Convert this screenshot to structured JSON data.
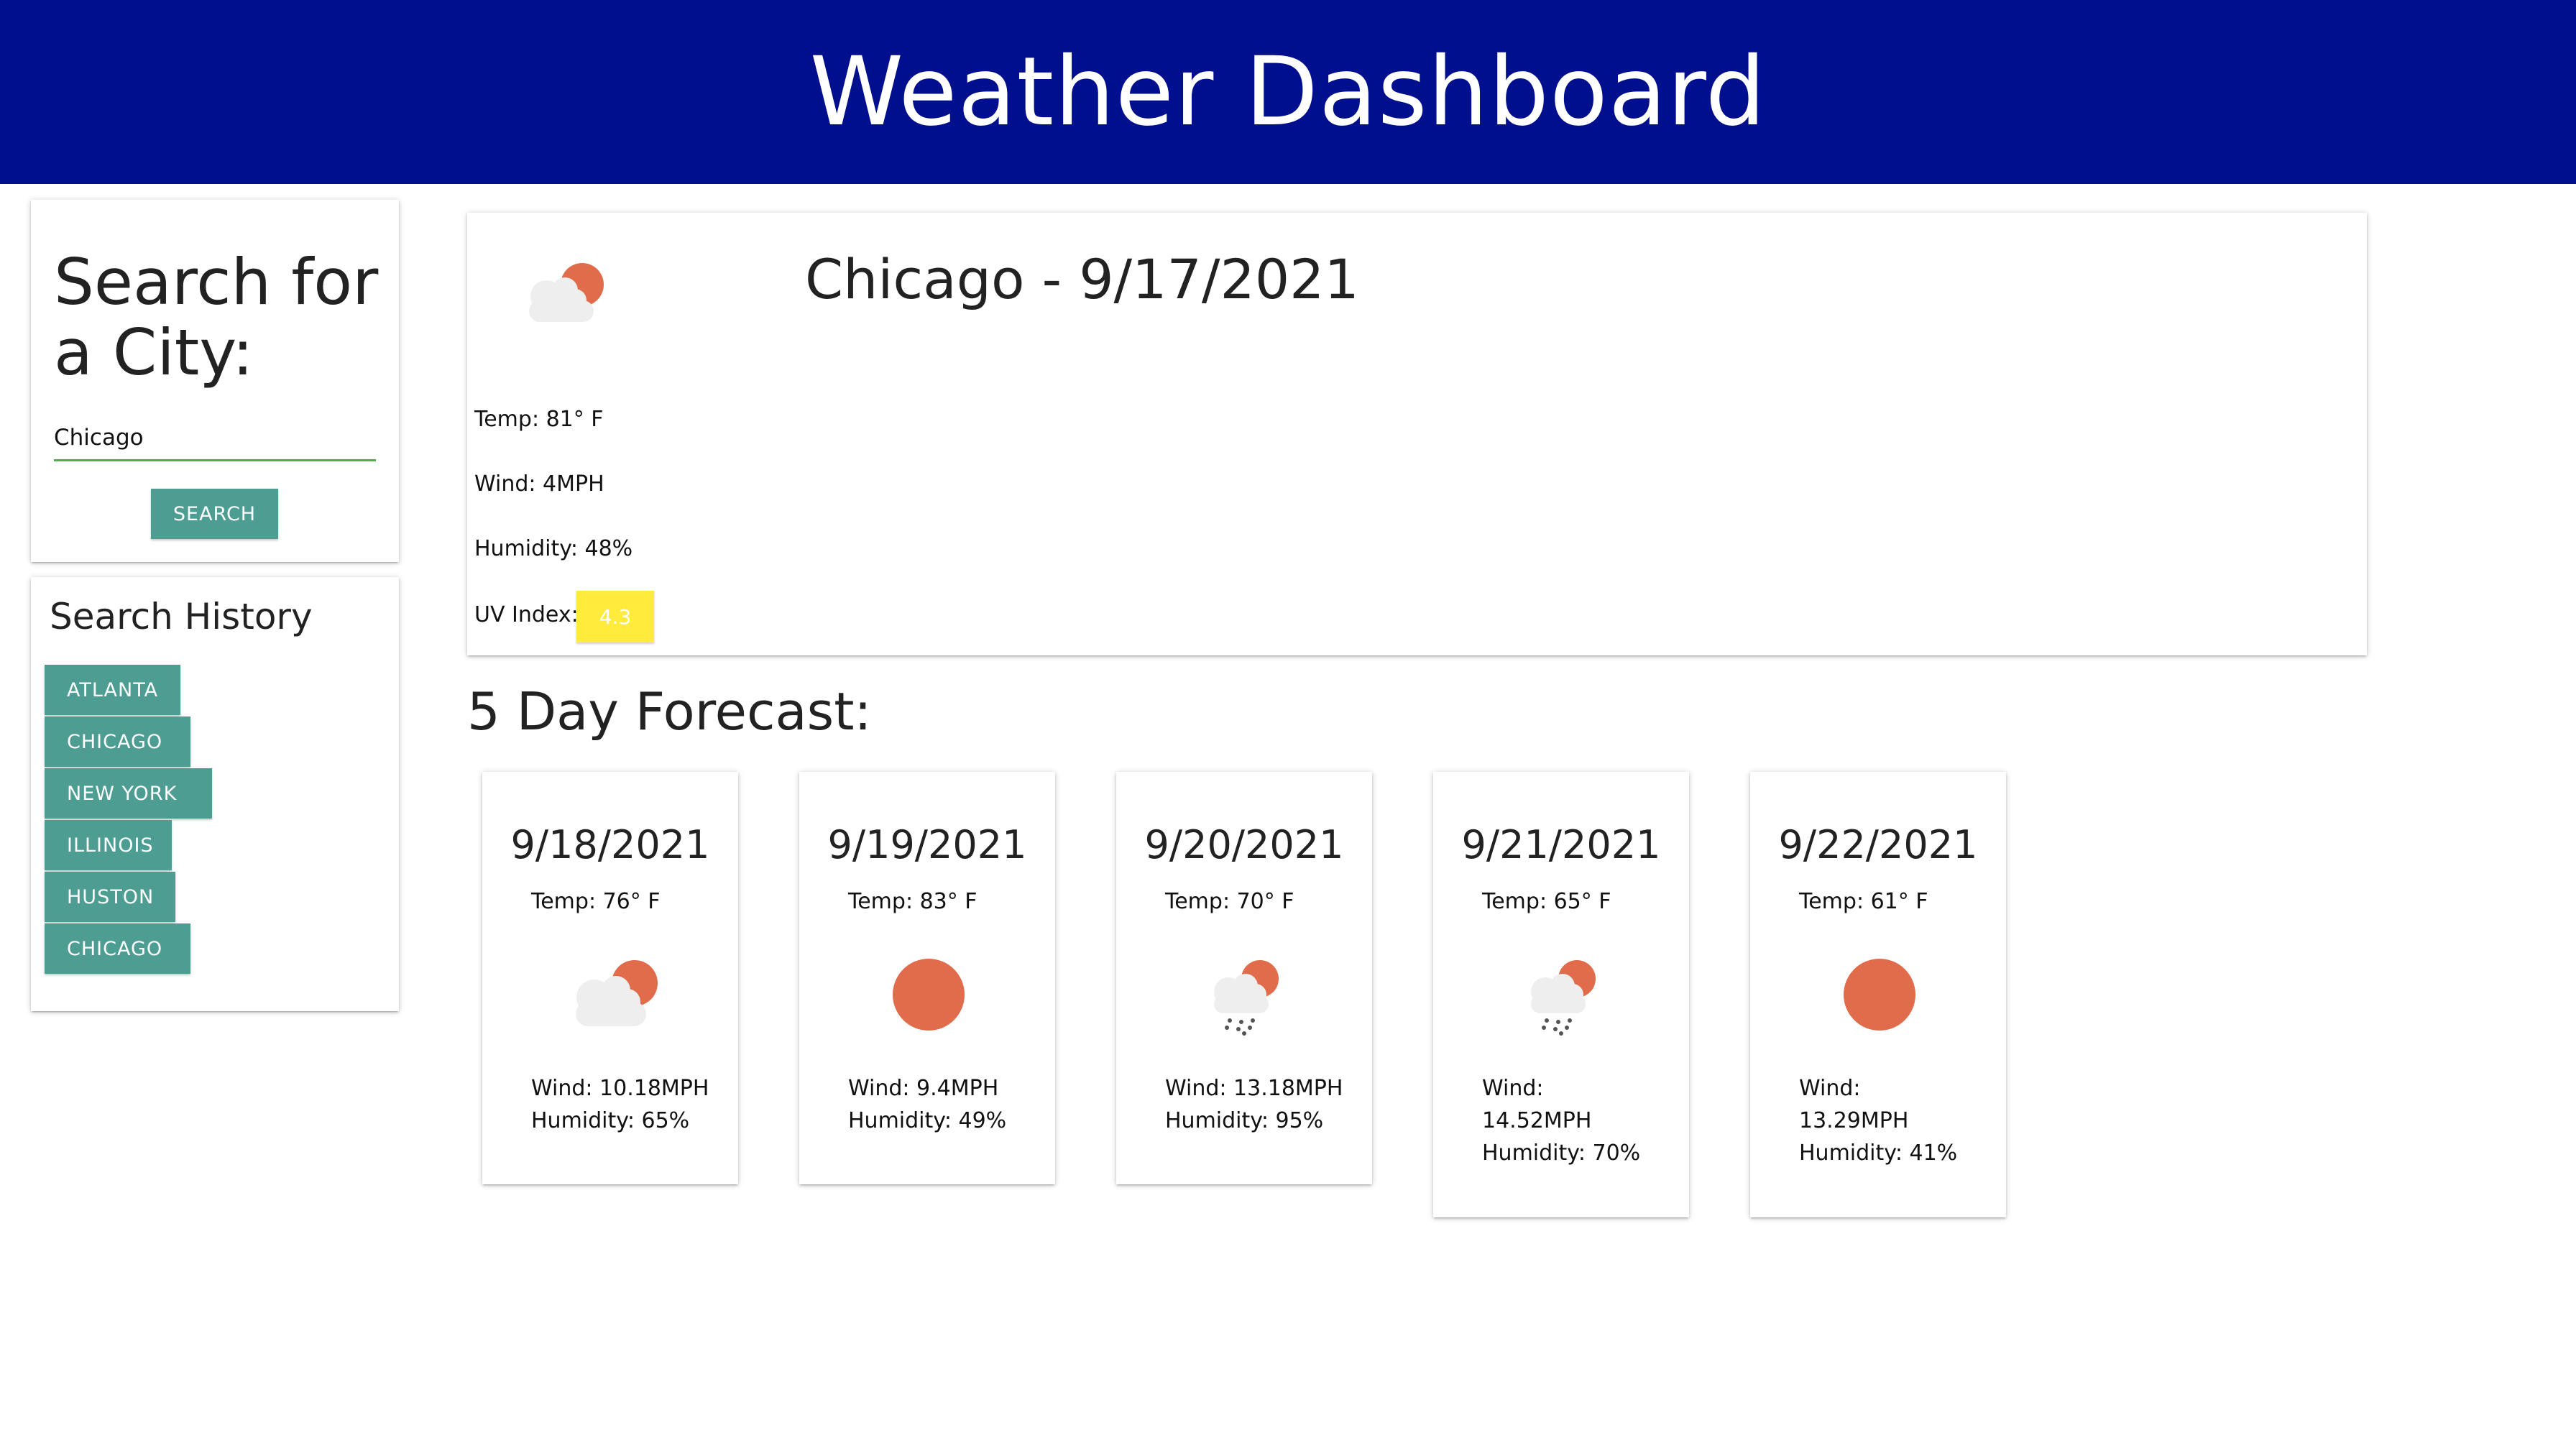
{
  "header": {
    "title": "Weather Dashboard"
  },
  "search": {
    "title": "Search for a City:",
    "input_value": "Chicago",
    "button_label": "SEARCH"
  },
  "history": {
    "title": "Search History",
    "items": [
      "ATLANTA",
      "CHICAGO",
      "NEW YORK",
      "ILLINOIS",
      "HUSTON",
      "CHICAGO"
    ]
  },
  "current": {
    "title": "Chicago - 9/17/2021",
    "icon": "sun-behind-cloud-icon",
    "temp": "Temp: 81° F",
    "wind": "Wind: 4MPH",
    "humidity": "Humidity: 48%",
    "uv_label": "UV Index:",
    "uv_value": "4.3",
    "uv_color": "#ffeb3b"
  },
  "forecast": {
    "heading": "5 Day Forecast:",
    "days": [
      {
        "date": "9/18/2021",
        "temp": "Temp: 76° F",
        "icon": "sun-behind-cloud-icon",
        "wind": "Wind: 10.18MPH",
        "humidity": "Humidity: 65%"
      },
      {
        "date": "9/19/2021",
        "temp": "Temp: 83° F",
        "icon": "sun-icon",
        "wind": "Wind: 9.4MPH",
        "humidity": "Humidity: 49%"
      },
      {
        "date": "9/20/2021",
        "temp": "Temp: 70° F",
        "icon": "rain-cloud-sun-icon",
        "wind": "Wind: 13.18MPH",
        "humidity": "Humidity: 95%"
      },
      {
        "date": "9/21/2021",
        "temp": "Temp: 65° F",
        "icon": "rain-cloud-sun-icon",
        "wind": "Wind:",
        "wind2": "14.52MPH",
        "humidity": "Humidity: 70%"
      },
      {
        "date": "9/22/2021",
        "temp": "Temp: 61° F",
        "icon": "sun-icon",
        "wind": "Wind:",
        "wind2": "13.29MPH",
        "humidity": "Humidity: 41%"
      }
    ]
  },
  "colors": {
    "header_bg": "#000f8e",
    "button_bg": "#4d9d93",
    "sun": "#e06c4c",
    "cloud": "#eeeeee"
  }
}
